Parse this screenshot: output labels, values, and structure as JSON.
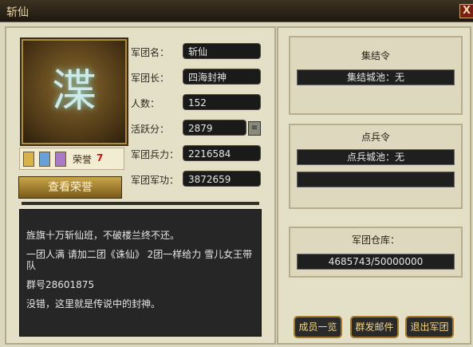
{
  "window": {
    "title": "斩仙",
    "close_glyph": "X"
  },
  "emblem": {
    "glyph": "渫"
  },
  "honor": {
    "label": "荣誉",
    "count": "7"
  },
  "view_honor_button": "查看荣誉",
  "info_fields": [
    {
      "label": "军团名：",
      "value": "斩仙"
    },
    {
      "label": "军团长：",
      "value": "四海封神"
    },
    {
      "label": "人数：",
      "value": "152"
    },
    {
      "label": "活跃分：",
      "value": "2879"
    },
    {
      "label": "军团兵力：",
      "value": "2216584"
    },
    {
      "label": "军团军功：",
      "value": "3872659"
    }
  ],
  "notice": {
    "lines": [
      "旌旗十万斩仙班，不破楼兰终不还。",
      "一团人满 请加二团《诛仙》 2团一样给力 雪儿女王带队",
      "群号28601875",
      "没错，这里就是传说中的封神。"
    ]
  },
  "rally": {
    "title": "集结令",
    "status": "集结城池：无"
  },
  "muster": {
    "title": "点兵令",
    "status": "点兵城池：无",
    "status2": ""
  },
  "warehouse": {
    "title": "军团仓库：",
    "value": "4685743/50000000"
  },
  "buttons": {
    "members": "成员一览",
    "mail": "群发邮件",
    "quit": "退出军团"
  }
}
